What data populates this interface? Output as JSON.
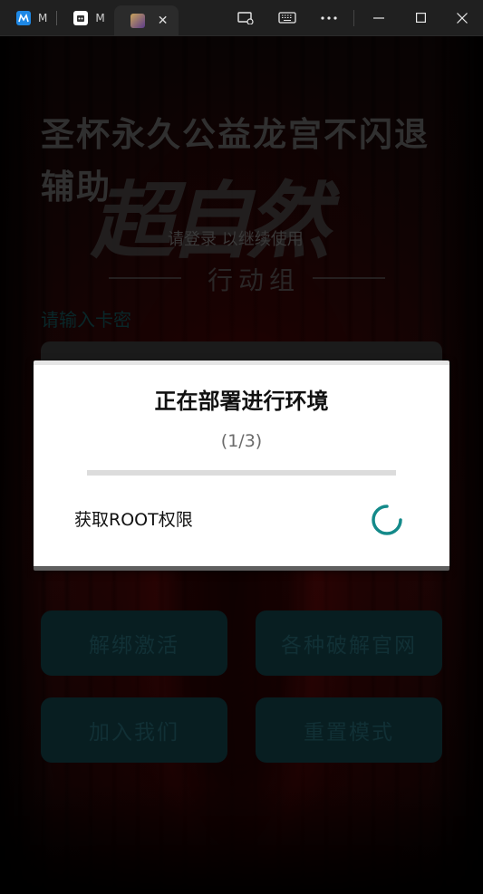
{
  "titlebar": {
    "tabs": [
      {
        "label": "M",
        "icon": "app-icon-blue",
        "color": "#1e88e5"
      },
      {
        "label": "M",
        "icon": "robot-icon",
        "color": "#ffffff"
      },
      {
        "label": "",
        "icon": "game-icon",
        "active": true
      }
    ],
    "controls": [
      "cast-icon",
      "keyboard-icon",
      "more-icon",
      "minimize-icon",
      "maximize-icon",
      "close-icon"
    ]
  },
  "app": {
    "heading": "圣杯永久公益龙宫不闪退辅助",
    "logo_text": "超自然",
    "logo_sub": "行动组",
    "subtitle": "请登录 以继续使用",
    "input_label": "请输入卡密",
    "buttons": {
      "unbind": "解绑激活",
      "cracks": "各种破解官网",
      "join": "加入我们",
      "reset": "重置模式"
    }
  },
  "dialog": {
    "title": "正在部署进行环境",
    "step": "(1/3)",
    "progress": 0,
    "task": "获取ROOT权限",
    "spinner_color": "#148a8a"
  }
}
